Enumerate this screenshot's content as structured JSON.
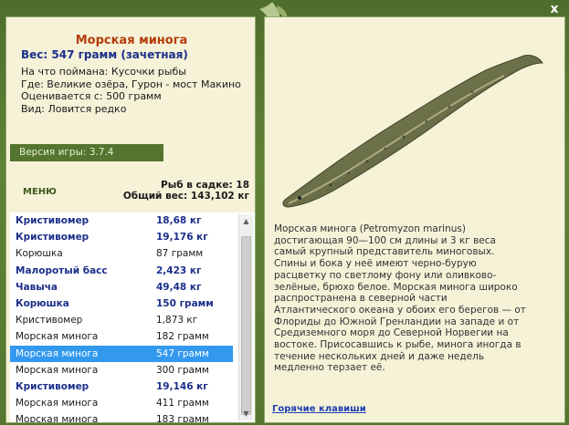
{
  "window": {
    "close_label": "x"
  },
  "fish": {
    "name": "Морская минога",
    "weight_line": "Вес: 547 грамм (зачетная)",
    "bait_line": "На что поймана: Кусочки рыбы",
    "location_line": "Где: Великие озёра, Гурон - мост Макино",
    "value_line": "Оценивается с: 500 грамм",
    "view_line": "Вид: Ловится редко"
  },
  "version": "Версия игры: 3.7.4",
  "menu_label": "МЕНЮ",
  "stats": {
    "count_line": "Рыб в садке: 18",
    "total_line": "Общий вес: 143,102 кг"
  },
  "catch_list": [
    {
      "name": "Кристивомер",
      "weight": "18,68 кг",
      "bold": true
    },
    {
      "name": "Кристивомер",
      "weight": "19,176 кг",
      "bold": true
    },
    {
      "name": "Корюшка",
      "weight": "87 грамм",
      "bold": false
    },
    {
      "name": "Малоротый басс",
      "weight": "2,423 кг",
      "bold": true
    },
    {
      "name": "Чавыча",
      "weight": "49,48 кг",
      "bold": true
    },
    {
      "name": "Корюшка",
      "weight": "150 грамм",
      "bold": true
    },
    {
      "name": "Кристивомер",
      "weight": "1,873 кг",
      "bold": false
    },
    {
      "name": "Морская минога",
      "weight": "182 грамм",
      "bold": false
    },
    {
      "name": "Морская минога",
      "weight": "547 грамм",
      "bold": false,
      "selected": true
    },
    {
      "name": "Морская минога",
      "weight": "300 грамм",
      "bold": false
    },
    {
      "name": "Кристивомер",
      "weight": "19,146 кг",
      "bold": true
    },
    {
      "name": "Морская минога",
      "weight": "411 грамм",
      "bold": false
    },
    {
      "name": "Морская минога",
      "weight": "183 грамм",
      "bold": false
    }
  ],
  "description": "Морская минога (Petromyzon marinus) достигающая 90—100 см длины и 3 кг веса самый крупный представитель миноговых. Спины и бока у неё имеют черно-бурую расцветку по светлому фону или оливково-зелёные, брюхо белое. Морская минога широко распространена в северной части Атлантического океана у обоих его берегов — от Флориды до Южной Гренландии на западе и от Средиземного моря до Северной Норвегии на востоке. Присосавшись к рыбе, минога иногда в течение нескольких дней и даже недель медленно терзает её.",
  "hotkeys_label": "Горячие клавиши",
  "colors": {
    "frame_green": "#5a7a32",
    "panel_bg": "#f5f2d8",
    "title_orange": "#b43c0a",
    "accent_blue": "#1c2f8a",
    "selection_blue": "#3399ee"
  },
  "icons": {
    "logo": "fish-logo-icon",
    "close": "close-icon",
    "scroll_up": "arrow-up-icon",
    "scroll_down": "arrow-down-icon"
  }
}
